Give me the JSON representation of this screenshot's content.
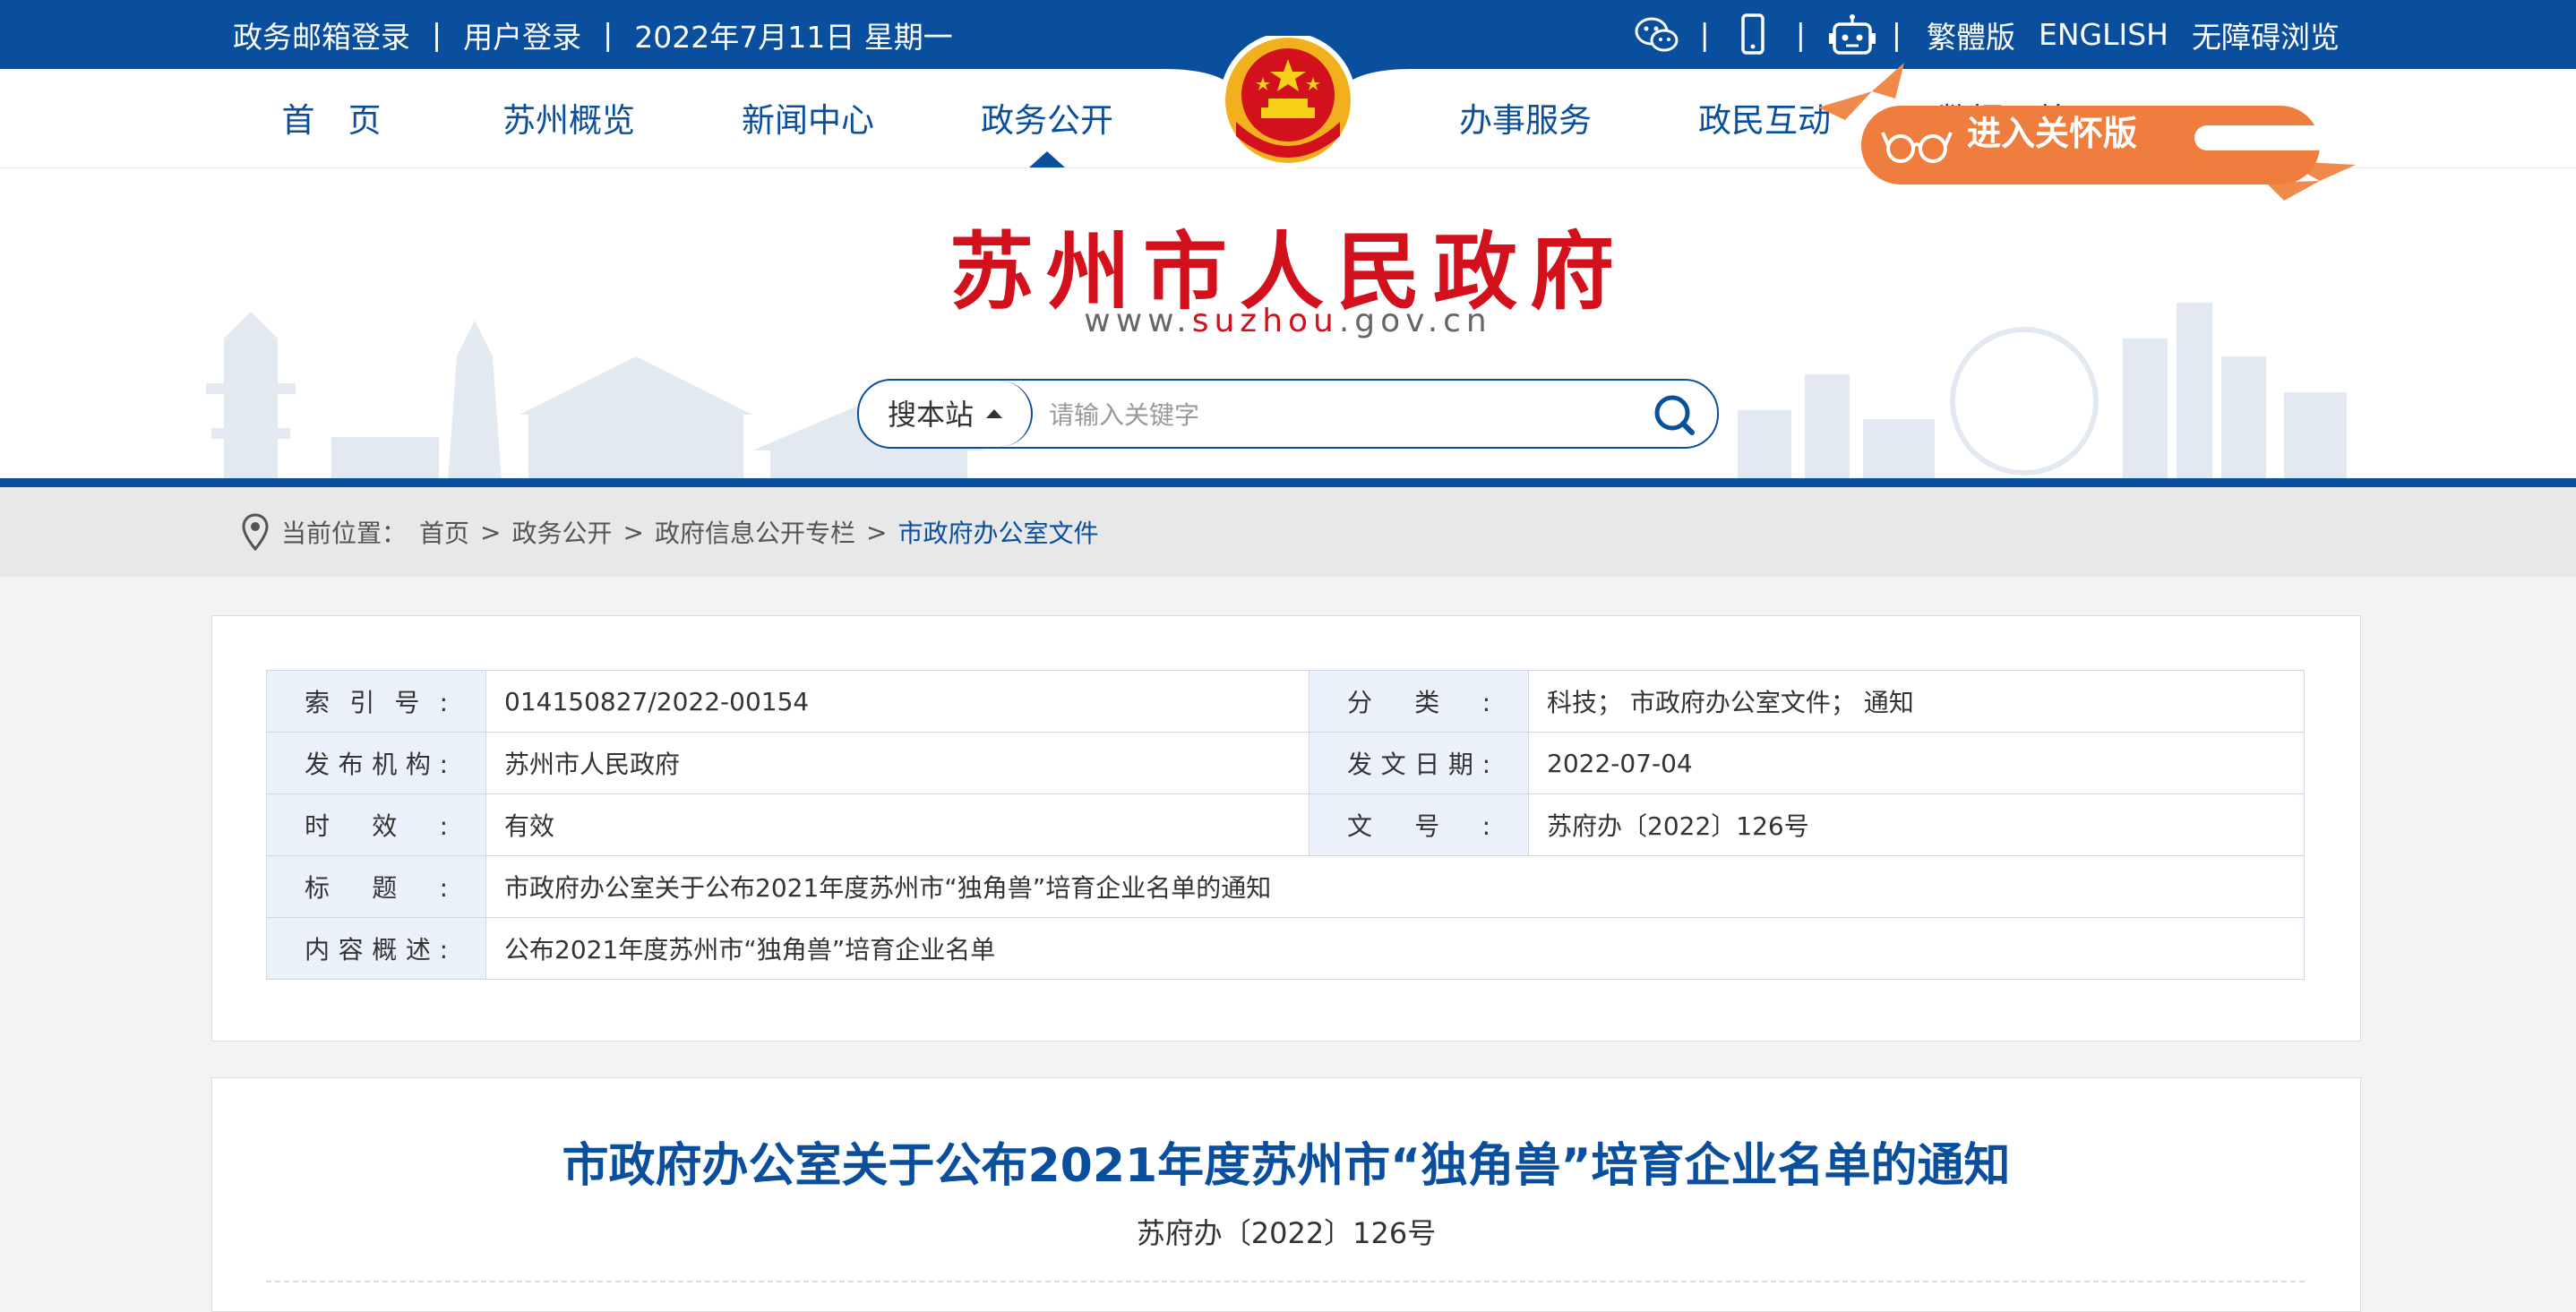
{
  "topbar": {
    "mail_login": "政务邮箱登录",
    "sep": "|",
    "user_login": "用户登录",
    "date": "2022年7月11日 星期一",
    "traditional": "繁體版",
    "english": "ENGLISH",
    "accessible": "无障碍浏览"
  },
  "nav": {
    "items": [
      "首　页",
      "苏州概览",
      "新闻中心",
      "政务公开",
      "办事服务",
      "政民互动",
      "数据开放"
    ],
    "active_index": 3
  },
  "header": {
    "title": "苏州市人民政府",
    "url_pre": "www.",
    "url_red": "suzhou",
    "url_post": ".gov.cn",
    "search_scope": "搜本站",
    "search_placeholder": "请输入关键字",
    "care_label": "进入关怀版"
  },
  "breadcrumb": {
    "label": "当前位置：",
    "items": [
      "首页",
      "政务公开",
      "政府信息公开专栏"
    ],
    "current": "市政府办公室文件",
    "separator": ">"
  },
  "meta": {
    "index_label": "索引号:",
    "index_value": "014150827/2022-00154",
    "category_label": "分类:",
    "category_value": "科技； 市政府办公室文件； 通知",
    "publisher_label": "发布机构:",
    "publisher_value": "苏州市人民政府",
    "date_label": "发文日期:",
    "date_value": "2022-07-04",
    "validity_label": "时效:",
    "validity_value": "有效",
    "docno_label": "文号:",
    "docno_value": "苏府办〔2022〕126号",
    "title_label": "标题:",
    "title_value": "市政府办公室关于公布2021年度苏州市“独角兽”培育企业名单的通知",
    "summary_label": "内容概述:",
    "summary_value": "公布2021年度苏州市“独角兽”培育企业名单"
  },
  "article": {
    "title": "市政府办公室关于公布2021年度苏州市“独角兽”培育企业名单的通知",
    "doc_number": "苏府办〔2022〕126号"
  },
  "colors": {
    "brand_blue": "#0a4f9d",
    "title_red": "#d3111c",
    "care_orange": "#ee7d3e"
  }
}
